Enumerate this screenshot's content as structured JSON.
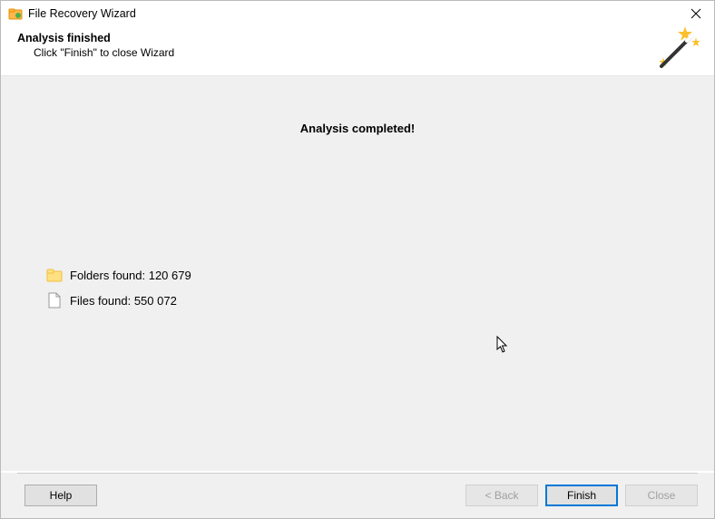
{
  "window": {
    "title": "File Recovery Wizard"
  },
  "header": {
    "heading": "Analysis finished",
    "subtitle": "Click \"Finish\" to close Wizard"
  },
  "content": {
    "completed_message": "Analysis completed!",
    "folders_label": "Folders found: 120 679",
    "files_label": "Files found: 550 072",
    "folders_count": 120679,
    "files_count": 550072
  },
  "buttons": {
    "help": "Help",
    "back": "< Back",
    "finish": "Finish",
    "close": "Close"
  }
}
